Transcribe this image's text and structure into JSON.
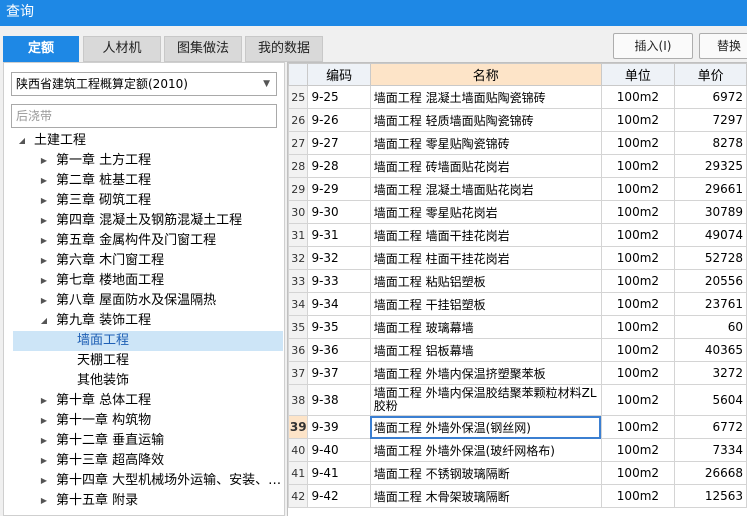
{
  "window": {
    "title": "查询"
  },
  "tabs": [
    {
      "label": "定额",
      "active": true
    },
    {
      "label": "人材机",
      "active": false
    },
    {
      "label": "图集做法",
      "active": false
    },
    {
      "label": "我的数据",
      "active": false
    }
  ],
  "buttons": {
    "insert": "插入(I)",
    "replace": "替换"
  },
  "quota_select": {
    "value": "陕西省建筑工程概算定额(2010)"
  },
  "search": {
    "placeholder": "后浇带"
  },
  "tree": [
    {
      "label": "土建工程",
      "expanded": true,
      "selected": false
    },
    {
      "label": "第一章 土方工程",
      "expanded": false,
      "selected": false
    },
    {
      "label": "第二章 桩基工程",
      "expanded": false,
      "selected": false
    },
    {
      "label": "第三章 砌筑工程",
      "expanded": false,
      "selected": false
    },
    {
      "label": "第四章 混凝土及钢筋混凝土工程",
      "expanded": false,
      "selected": false
    },
    {
      "label": "第五章 金属构件及门窗工程",
      "expanded": false,
      "selected": false
    },
    {
      "label": "第六章 木门窗工程",
      "expanded": false,
      "selected": false
    },
    {
      "label": "第七章 楼地面工程",
      "expanded": false,
      "selected": false
    },
    {
      "label": "第八章 屋面防水及保温隔热",
      "expanded": false,
      "selected": false
    },
    {
      "label": "第九章 装饰工程",
      "expanded": true,
      "selected": false
    },
    {
      "label": "墙面工程",
      "expanded": false,
      "selected": true
    },
    {
      "label": "天棚工程",
      "expanded": false,
      "selected": false
    },
    {
      "label": "其他装饰",
      "expanded": false,
      "selected": false
    },
    {
      "label": "第十章 总体工程",
      "expanded": false,
      "selected": false
    },
    {
      "label": "第十一章 构筑物",
      "expanded": false,
      "selected": false
    },
    {
      "label": "第十二章 垂直运输",
      "expanded": false,
      "selected": false
    },
    {
      "label": "第十三章 超高降效",
      "expanded": false,
      "selected": false
    },
    {
      "label": "第十四章 大型机械场外运输、安装、…",
      "expanded": false,
      "selected": false
    },
    {
      "label": "第十五章 附录",
      "expanded": false,
      "selected": false
    }
  ],
  "grid": {
    "headers": {
      "code": "编码",
      "name": "名称",
      "unit": "单位",
      "price": "单价"
    },
    "rows": [
      {
        "no": "25",
        "code": "9-25",
        "name": "墙面工程 混凝土墙面贴陶瓷锦砖",
        "unit": "100m2",
        "price": "6972"
      },
      {
        "no": "26",
        "code": "9-26",
        "name": "墙面工程 轻质墙面贴陶瓷锦砖",
        "unit": "100m2",
        "price": "7297"
      },
      {
        "no": "27",
        "code": "9-27",
        "name": "墙面工程 零星贴陶瓷锦砖",
        "unit": "100m2",
        "price": "8278"
      },
      {
        "no": "28",
        "code": "9-28",
        "name": "墙面工程 砖墙面贴花岗岩",
        "unit": "100m2",
        "price": "29325"
      },
      {
        "no": "29",
        "code": "9-29",
        "name": "墙面工程 混凝土墙面贴花岗岩",
        "unit": "100m2",
        "price": "29661"
      },
      {
        "no": "30",
        "code": "9-30",
        "name": "墙面工程 零星贴花岗岩",
        "unit": "100m2",
        "price": "30789"
      },
      {
        "no": "31",
        "code": "9-31",
        "name": "墙面工程 墙面干挂花岗岩",
        "unit": "100m2",
        "price": "49074"
      },
      {
        "no": "32",
        "code": "9-32",
        "name": "墙面工程 柱面干挂花岗岩",
        "unit": "100m2",
        "price": "52728"
      },
      {
        "no": "33",
        "code": "9-33",
        "name": "墙面工程 粘贴铝塑板",
        "unit": "100m2",
        "price": "20556"
      },
      {
        "no": "34",
        "code": "9-34",
        "name": "墙面工程 干挂铝塑板",
        "unit": "100m2",
        "price": "23761"
      },
      {
        "no": "35",
        "code": "9-35",
        "name": "墙面工程 玻璃幕墙",
        "unit": "100m2",
        "price": "60"
      },
      {
        "no": "36",
        "code": "9-36",
        "name": "墙面工程 铝板幕墙",
        "unit": "100m2",
        "price": "40365"
      },
      {
        "no": "37",
        "code": "9-37",
        "name": "墙面工程 外墙内保温挤塑聚苯板",
        "unit": "100m2",
        "price": "3272"
      },
      {
        "no": "38",
        "code": "9-38",
        "name": "墙面工程 外墙内保温胶结聚苯颗粒材料ZL胶粉",
        "unit": "100m2",
        "price": "5604",
        "tall": true
      },
      {
        "no": "39",
        "code": "9-39",
        "name": "墙面工程 外墙外保温(钢丝网)",
        "unit": "100m2",
        "price": "6772",
        "selected": true
      },
      {
        "no": "40",
        "code": "9-40",
        "name": "墙面工程 外墙外保温(玻纤网格布)",
        "unit": "100m2",
        "price": "7334"
      },
      {
        "no": "41",
        "code": "9-41",
        "name": "墙面工程 不锈钢玻璃隔断",
        "unit": "100m2",
        "price": "26668"
      },
      {
        "no": "42",
        "code": "9-42",
        "name": "墙面工程 木骨架玻璃隔断",
        "unit": "100m2",
        "price": "12563"
      }
    ]
  }
}
